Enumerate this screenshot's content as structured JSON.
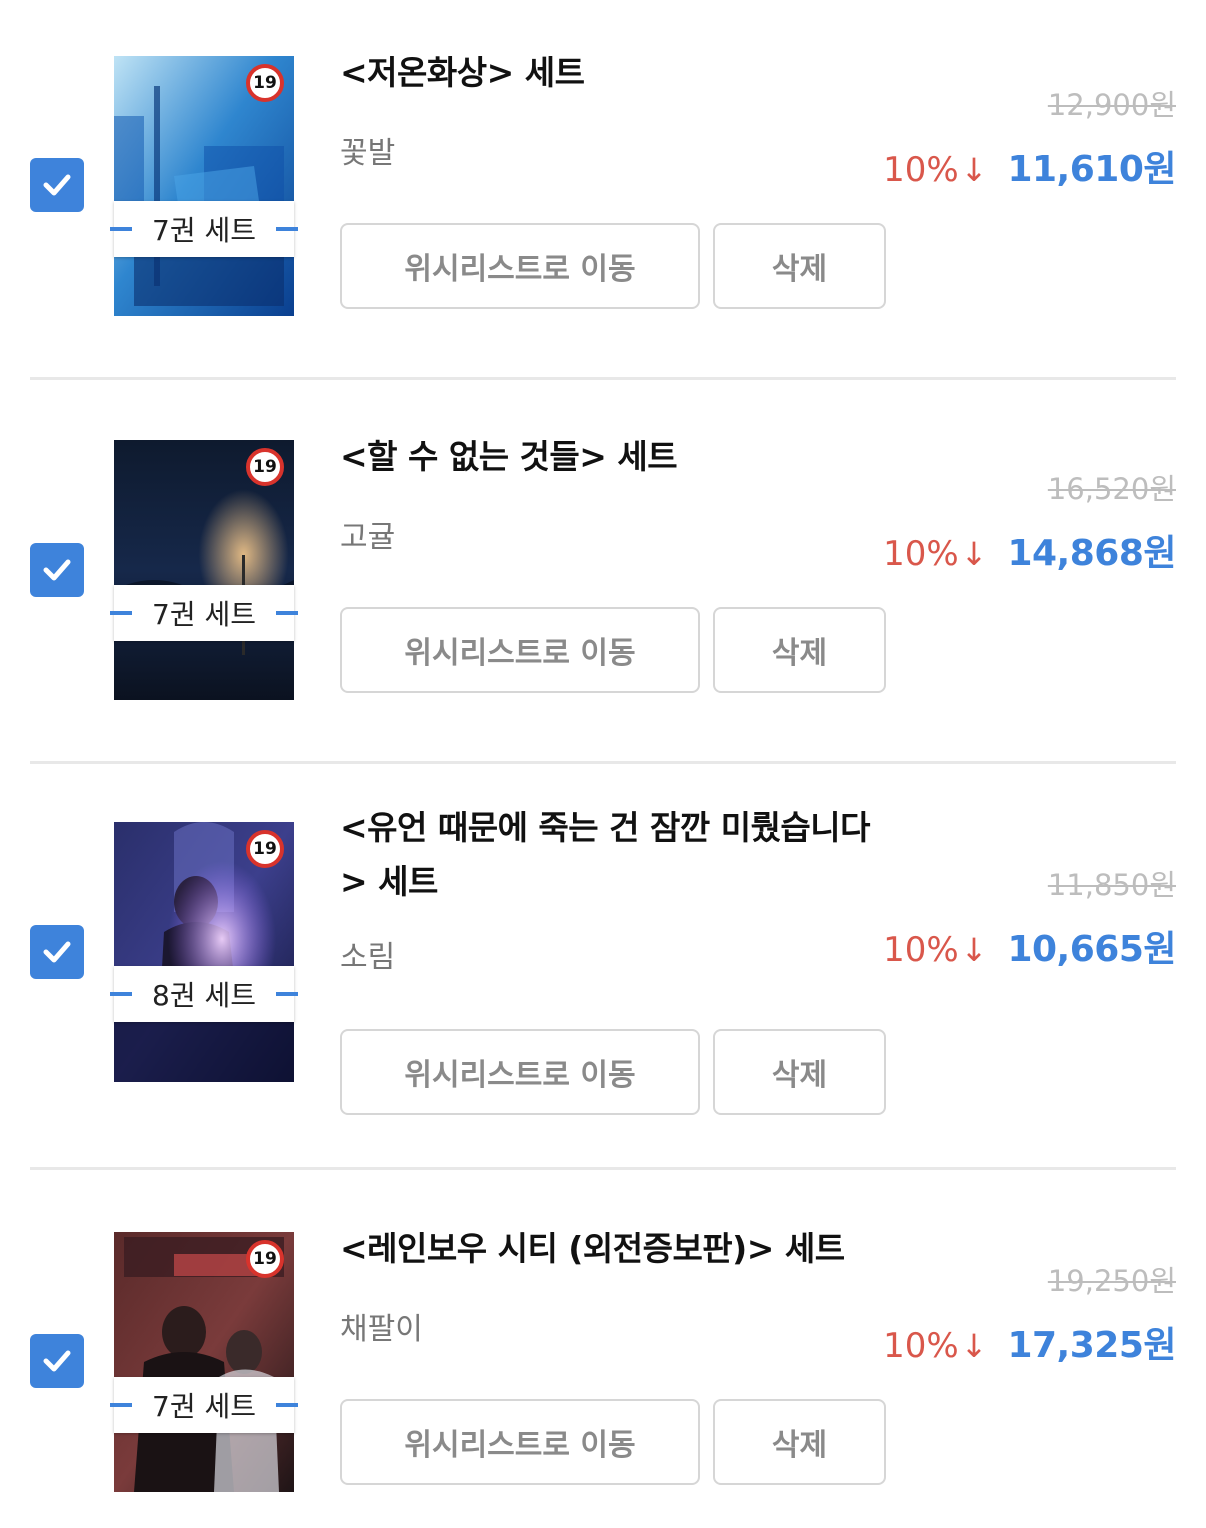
{
  "items": [
    {
      "title": "<저온화상> 세트",
      "author": "꽃발",
      "set_count": "7권 세트",
      "age_badge": "19",
      "original_price": "12,900원",
      "discount": "10%",
      "discount_arrow": "↓",
      "final_price": "11,610원",
      "wishlist_label": "위시리스트로 이동",
      "delete_label": "삭제",
      "checked": true
    },
    {
      "title": "<할 수 없는 것들> 세트",
      "author": "고귤",
      "set_count": "7권 세트",
      "age_badge": "19",
      "original_price": "16,520원",
      "discount": "10%",
      "discount_arrow": "↓",
      "final_price": "14,868원",
      "wishlist_label": "위시리스트로 이동",
      "delete_label": "삭제",
      "checked": true
    },
    {
      "title": "<유언 때문에 죽는 건 잠깐 미뤘습니다> 세트",
      "author": "소림",
      "set_count": "8권 세트",
      "age_badge": "19",
      "original_price": "11,850원",
      "discount": "10%",
      "discount_arrow": "↓",
      "final_price": "10,665원",
      "wishlist_label": "위시리스트로 이동",
      "delete_label": "삭제",
      "checked": true
    },
    {
      "title": "<레인보우 시티 (외전증보판)> 세트",
      "author": "채팔이",
      "set_count": "7권 세트",
      "age_badge": "19",
      "original_price": "19,250원",
      "discount": "10%",
      "discount_arrow": "↓",
      "final_price": "17,325원",
      "wishlist_label": "위시리스트로 이동",
      "delete_label": "삭제",
      "checked": true
    }
  ],
  "colors": {
    "accent_blue": "#3e83db",
    "discount_red": "#d9574b",
    "strike_gray": "#bdbdbd",
    "author_gray": "#777777",
    "button_border": "#d6d6d6"
  },
  "icons": {
    "checkbox": "checkmark-icon",
    "discount": "down-arrow-icon",
    "age": "age-19-badge-icon"
  }
}
